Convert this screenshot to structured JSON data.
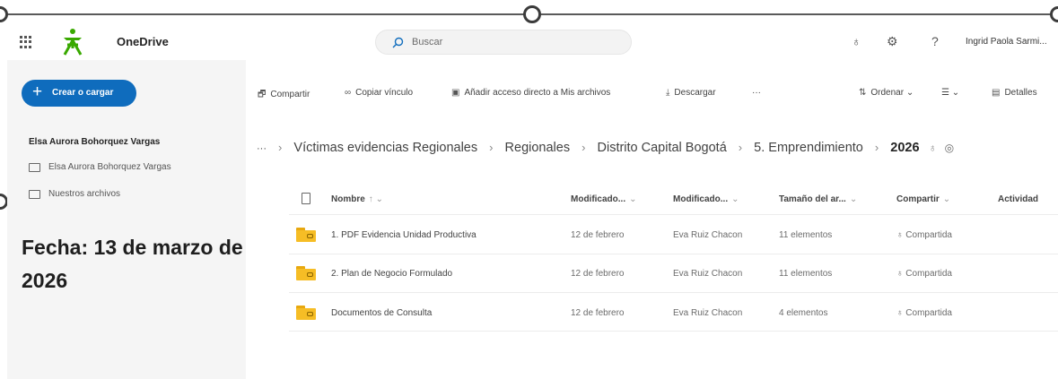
{
  "app": {
    "name": "OneDrive",
    "user": "Ingrid Paola Sarmi..."
  },
  "search": {
    "placeholder": "Buscar"
  },
  "sidebar": {
    "create_label": "Crear o cargar",
    "owner": "Elsa Aurora Bohorquez Vargas",
    "items": [
      {
        "label": "Elsa Aurora Bohorquez Vargas",
        "icon": "folder-icon"
      },
      {
        "label": "Nuestros archivos",
        "icon": "shared-folder-icon"
      }
    ]
  },
  "commands": {
    "share": "Compartir",
    "copy_link": "Copiar vínculo",
    "add_shortcut": "Añadir acceso directo a Mis archivos",
    "download": "Descargar",
    "more": "···",
    "sort": "Ordenar",
    "details": "Detalles"
  },
  "breadcrumb": {
    "ellipsis": "···",
    "items": [
      "Víctimas evidencias Regionales",
      "Regionales",
      "Distrito Capital Bogotá",
      "5. Emprendimiento"
    ],
    "current": "2026"
  },
  "table": {
    "columns": [
      "Nombre",
      "Modificado...",
      "Modificado...",
      "Tamaño del ar...",
      "Compartir",
      "Actividad"
    ],
    "rows": [
      {
        "name": "1. PDF Evidencia Unidad Productiva",
        "modified": "12 de febrero",
        "modified_by": "Eva Ruiz Chacon",
        "size": "11 elementos",
        "sharing": "Compartida"
      },
      {
        "name": "2. Plan de Negocio Formulado",
        "modified": "12 de febrero",
        "modified_by": "Eva Ruiz Chacon",
        "size": "11 elementos",
        "sharing": "Compartida"
      },
      {
        "name": "Documentos de Consulta",
        "modified": "12 de febrero",
        "modified_by": "Eva Ruiz Chacon",
        "size": "4 elementos",
        "sharing": "Compartida"
      }
    ]
  },
  "overlay": {
    "fecha": "Fecha: 13 de marzo de 2026"
  },
  "colors": {
    "accent": "#0f6cbd",
    "folder": "#f6bd25"
  }
}
